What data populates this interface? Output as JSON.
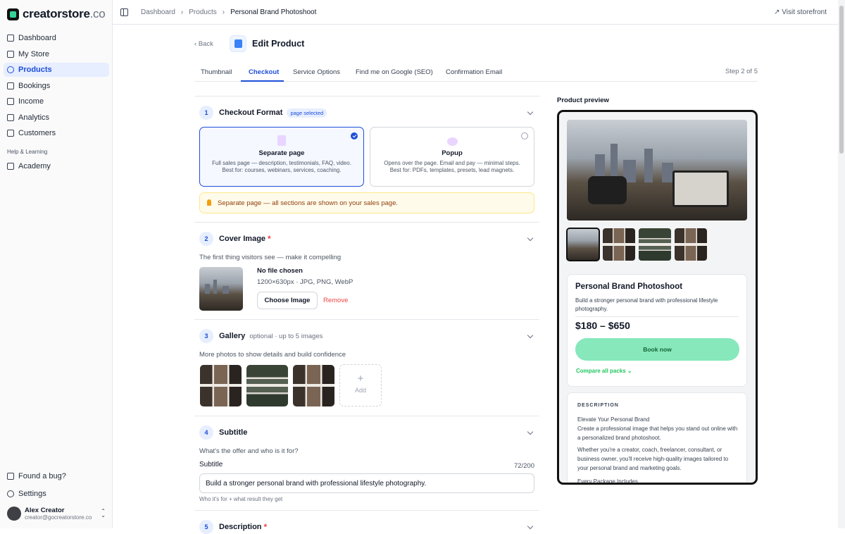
{
  "brand": {
    "name": "creatorstore",
    "tld": ".co"
  },
  "sidebar": {
    "items": [
      {
        "label": "Dashboard",
        "icon": "grid-icon"
      },
      {
        "label": "My Store",
        "icon": "store-icon"
      },
      {
        "label": "Products",
        "icon": "products-icon",
        "active": true
      },
      {
        "label": "Bookings",
        "icon": "calendar-icon"
      },
      {
        "label": "Income",
        "icon": "wallet-icon"
      },
      {
        "label": "Analytics",
        "icon": "chart-icon"
      },
      {
        "label": "Customers",
        "icon": "users-icon"
      }
    ],
    "section_label": "Help & Learning",
    "academy": "Academy",
    "bug": "Found a bug?",
    "settings": "Settings",
    "user": {
      "name": "Alex Creator",
      "email": "creator@gocreatorstore.co"
    }
  },
  "topbar": {
    "breadcrumbs": [
      "Dashboard",
      "Products",
      "Personal Brand Photoshoot"
    ],
    "visit": "Visit storefront"
  },
  "header": {
    "back": "Back",
    "title": "Edit Product"
  },
  "tabs": [
    "Thumbnail",
    "Checkout",
    "Service Options",
    "Find me on Google (SEO)",
    "Confirmation Email"
  ],
  "active_tab": "Checkout",
  "step": "Step 2 of 5",
  "checkout_format": {
    "num": "1",
    "title": "Checkout Format",
    "pill": "page selected",
    "options": [
      {
        "title": "Separate page",
        "desc1": "Full sales page — description, testimonials, FAQ, video.",
        "desc2": "Best for: courses, webinars, services, coaching."
      },
      {
        "title": "Popup",
        "desc1": "Opens over the page. Email and pay — minimal steps.",
        "desc2": "Best for: PDFs, templates, presets, lead magnets."
      }
    ],
    "note": "Separate page — all sections are shown on your sales page."
  },
  "cover": {
    "num": "2",
    "title": "Cover Image",
    "required": "*",
    "hint": "The first thing visitors see — make it compelling",
    "file": "No file chosen",
    "meta": "1200×630px · JPG, PNG, WebP",
    "choose": "Choose Image",
    "remove": "Remove"
  },
  "gallery": {
    "num": "3",
    "title": "Gallery",
    "optional": "optional · up to 5 images",
    "hint": "More photos to show details and build confidence",
    "add_plus": "+",
    "add": "Add"
  },
  "subtitle": {
    "num": "4",
    "title": "Subtitle",
    "hint": "What's the offer and who is it for?",
    "label": "Subtitle",
    "counter": "72/200",
    "value": "Build a stronger personal brand with professional lifestyle photography.",
    "small_hint": "Who it's for + what result they get"
  },
  "description": {
    "num": "5",
    "title": "Description",
    "required": "*"
  },
  "preview": {
    "label": "Product preview",
    "title": "Personal Brand Photoshoot",
    "subtitle": "Build a stronger personal brand with professional lifestyle photography.",
    "price": "$180 – $650",
    "book": "Book now",
    "compare": "Compare all packs",
    "desc_heading": "DESCRIPTION",
    "desc_lines": [
      "Elevate Your Personal Brand",
      "Create a professional image that helps you stand out online with a personalized brand photoshoot.",
      "Whether you're a creator, coach, freelancer, consultant, or business owner, you'll receive high-quality images tailored to your personal brand and marketing goals.",
      "Every Package Includes"
    ]
  },
  "colors": {
    "accent": "#1d4ed8",
    "book_button": "#86e8bb",
    "required": "#ef4444"
  }
}
